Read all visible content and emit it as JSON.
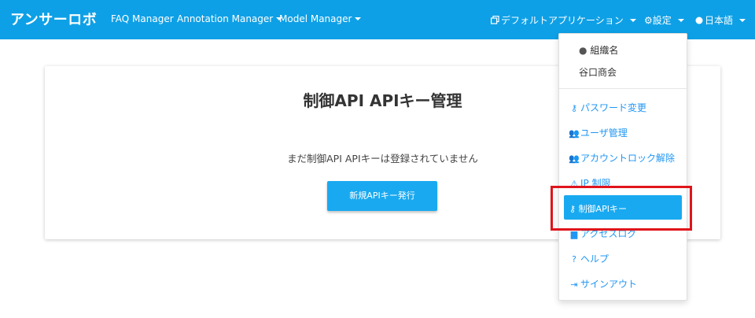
{
  "navbar": {
    "brand": "アンサーロボ",
    "links": [
      "FAQ Manager",
      "Annotation Manager",
      "Model Manager"
    ],
    "app_selector": "デフォルトアプリケーション",
    "settings": "設定",
    "language": "日本語",
    "color": "#0ea0e6"
  },
  "card": {
    "title": "制御API APIキー管理",
    "message": "まだ制御API APIキーは登録されていません",
    "issue_button": "新規APIキー発行"
  },
  "dropdown": {
    "org_label": "組織名",
    "company": "谷口商会",
    "items": [
      {
        "label": "パスワード変更",
        "icon": "key-icon"
      },
      {
        "label": "ユーザ管理",
        "icon": "users-icon"
      },
      {
        "label": "アカウントロック解除",
        "icon": "users-icon"
      },
      {
        "label": "IP 制限",
        "icon": "warning-icon"
      },
      {
        "label": "制御APIキー",
        "icon": "key-icon",
        "active": true
      },
      {
        "label": "アクセスログ",
        "icon": "file-icon"
      },
      {
        "label": "ヘルプ",
        "icon": "help-icon"
      },
      {
        "label": "サインアウト",
        "icon": "sign-out-icon"
      }
    ]
  },
  "colors": {
    "accent": "#19a9f0",
    "link": "#2196f3",
    "highlight": "#e0141b"
  }
}
